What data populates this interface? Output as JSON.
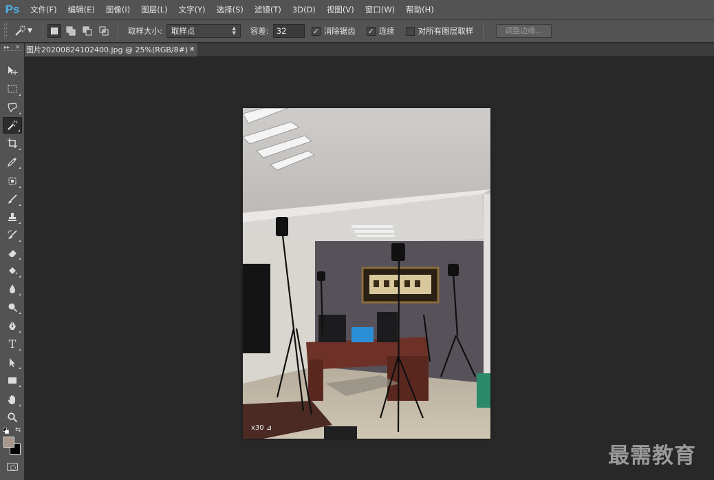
{
  "app": {
    "logo": "Ps"
  },
  "menu": [
    "文件(F)",
    "编辑(E)",
    "图像(I)",
    "图层(L)",
    "文字(Y)",
    "选择(S)",
    "滤镜(T)",
    "3D(D)",
    "视图(V)",
    "窗口(W)",
    "帮助(H)"
  ],
  "options": {
    "sample_size_label": "取样大小:",
    "sample_size_value": "取样点",
    "tolerance_label": "容差:",
    "tolerance_value": "32",
    "antialias_label": "消除锯齿",
    "antialias_checked": true,
    "contiguous_label": "连续",
    "contiguous_checked": true,
    "sample_all_label": "对所有图层取样",
    "sample_all_checked": false,
    "refine_edge_label": "调整边缘..."
  },
  "document": {
    "tab_title": "图片20200824102400.jpg @ 25%(RGB/8#) *",
    "zoom_overlay": "x30 ⊿"
  },
  "tools": {
    "active": "magic-wand-tool",
    "type_glyph": "T"
  },
  "colors": {
    "foreground": "#a8968a",
    "background": "#000000",
    "accent": "#4fb3f0"
  },
  "watermark": "最需教育"
}
